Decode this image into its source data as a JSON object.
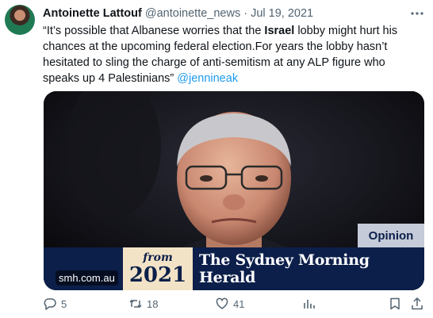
{
  "tweet": {
    "author_name": "Antoinette Lattouf",
    "handle": "@antoinette_news",
    "separator": "·",
    "date": "Jul 19, 2021",
    "text_part1": "“It’s possible that Albanese worries that the ",
    "text_bold": "Israel",
    "text_part2": " lobby might hurt his chances at the upcoming federal election.For years the lobby hasn’t hesitated to sling the charge of anti-semitism at any ALP figure who speaks up 4 Palestinians” ",
    "mention": "@jennineak"
  },
  "card": {
    "opinion_label": "Opinion",
    "domain": "smh.com.au",
    "from_label": "from",
    "year": "2021",
    "masthead": "The Sydney Morning Herald"
  },
  "actions": {
    "replies": "5",
    "retweets": "18",
    "likes": "41"
  },
  "icons": [
    "more-icon",
    "reply-icon",
    "retweet-icon",
    "like-icon",
    "views-icon",
    "bookmark-icon",
    "share-icon"
  ],
  "colors": {
    "link": "#1d9bf0",
    "muted": "#536471",
    "smh_navy": "#0c1f4a"
  }
}
